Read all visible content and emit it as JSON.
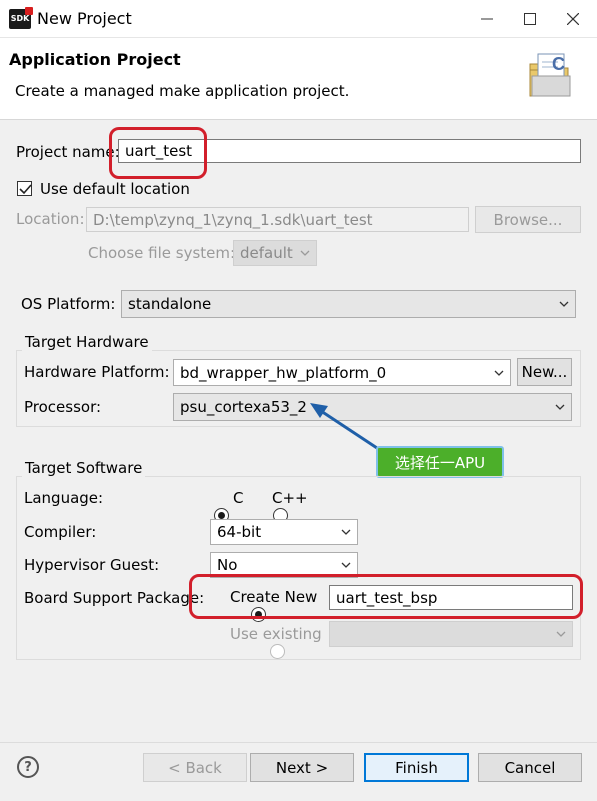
{
  "window": {
    "title": "New Project",
    "app_icon_label": "SDK"
  },
  "header": {
    "title": "Application Project",
    "subtitle": "Create a managed make application project.",
    "icon": "new-project-wizard-icon"
  },
  "project": {
    "name_label": "Project name:",
    "name_value": "uart_test",
    "use_default_label": "Use default location",
    "use_default_checked": true,
    "location_label": "Location:",
    "location_value": "D:\\temp\\zynq_1\\zynq_1.sdk\\uart_test",
    "browse_label": "Browse...",
    "fs_label": "Choose file system:",
    "fs_value": "default"
  },
  "os": {
    "label": "OS Platform:",
    "value": "standalone"
  },
  "target_hardware": {
    "group_label": "Target Hardware",
    "platform_label": "Hardware Platform:",
    "platform_value": "bd_wrapper_hw_platform_0",
    "new_label": "New...",
    "processor_label": "Processor:",
    "processor_value": "psu_cortexa53_2"
  },
  "callout": {
    "text": "选择任一APU"
  },
  "target_software": {
    "group_label": "Target Software",
    "language_label": "Language:",
    "lang_c": "C",
    "lang_cpp": "C++",
    "selected_language": "C",
    "compiler_label": "Compiler:",
    "compiler_value": "64-bit",
    "hypervisor_label": "Hypervisor Guest:",
    "hypervisor_value": "No",
    "bsp_label": "Board Support Package:",
    "create_new_label": "Create New",
    "bsp_name": "uart_test_bsp",
    "use_existing_label": "Use existing"
  },
  "footer": {
    "back": "< Back",
    "next": "Next >",
    "finish": "Finish",
    "cancel": "Cancel"
  },
  "colors": {
    "highlight_red": "#d21f2b",
    "callout_green": "#4caf2a",
    "arrow_blue": "#1f5fa8",
    "focus_blue": "#0078d7"
  }
}
